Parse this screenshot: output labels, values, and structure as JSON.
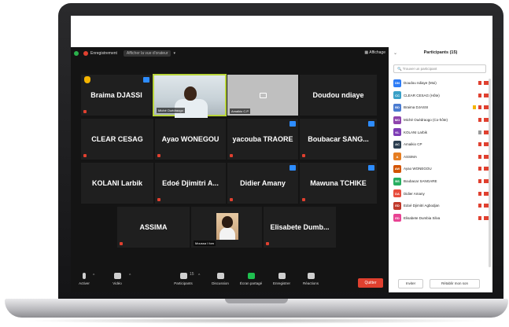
{
  "topbar": {
    "recording": "Enregistrement",
    "viewer": "Afficher la vue d'orateur",
    "display": "Affichage"
  },
  "tiles": {
    "braima": "Braima DJASSI",
    "michel": "Miché Ouédraogo",
    "amaikio": "Amaikio C.P",
    "doudou": "Doudou ndiaye",
    "clear": "CLEAR CESAG",
    "ayao": "Ayao WONEGOU",
    "yacouba": "yacouba TRAORE",
    "boubacar": "Boubacar SANG...",
    "kolani": "KOLANI Larbik",
    "edoe": "Edoé Djimitri A...",
    "didier": "Didier Amany",
    "mawuna": "Mawuna TCHIKE",
    "assima": "ASSIMA",
    "moussa": "Moussa I fom",
    "elisabete": "Elisabete Dumb..."
  },
  "toolbar": {
    "activer": "Activer",
    "video": "Vidéo",
    "participants": "Participants",
    "participants_count": "15",
    "discussion": "Discussion",
    "partager": "Écran partagé",
    "enregistrer": "Enregistrer",
    "reactions": "Réactions",
    "quitter": "Quitter"
  },
  "panel": {
    "title": "Participants (15)",
    "search_placeholder": "Trouver un participant",
    "invite": "Inviter",
    "unmute_all": "Rétablir mon son",
    "participants": [
      {
        "initials": "DN",
        "name": "Doudou ndiaye (Moi)",
        "color": "#2d7cf6"
      },
      {
        "initials": "CC",
        "name": "CLEAR CESAG (Hôte)",
        "color": "#3aa0c7"
      },
      {
        "initials": "BD",
        "name": "Braima DJASSI",
        "color": "#4a7bd0"
      },
      {
        "initials": "MO",
        "name": "Miché Ouédraogo (Co-hôte)",
        "color": "#8e44ad"
      },
      {
        "initials": "KL",
        "name": "KOLANI Larbik",
        "color": "#7d3cb5"
      },
      {
        "initials": "AC",
        "name": "Amaikio CP",
        "color": "#2c3e50"
      },
      {
        "initials": "A",
        "name": "ASSIMA",
        "color": "#e67e22"
      },
      {
        "initials": "AW",
        "name": "Ayao WONEGOU",
        "color": "#d35400"
      },
      {
        "initials": "BS",
        "name": "Boubacar SANGARE",
        "color": "#27ae60"
      },
      {
        "initials": "DA",
        "name": "Didier Amany",
        "color": "#e74c3c"
      },
      {
        "initials": "ED",
        "name": "Edoé Djimitri Agbodjan",
        "color": "#c0392b"
      },
      {
        "initials": "ED",
        "name": "Elisabete Dumbia Silva",
        "color": "#e84393"
      }
    ]
  }
}
